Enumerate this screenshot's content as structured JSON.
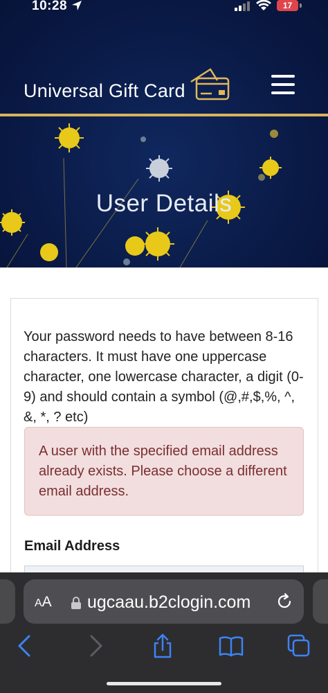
{
  "status_bar": {
    "time": "10:28",
    "battery": "17"
  },
  "header": {
    "brand": "Universal Gift Card",
    "hero_title": "User Details"
  },
  "content": {
    "password_hint": "Your password needs to have between 8-16 characters. It must have one uppercase character, one lowercase character, a digit (0-9) and should contain a symbol (@,#,$,%, ^, &, *, ? etc)",
    "error_message": "A user with the specified email address already exists. Please choose a different email address.",
    "email_label": "Email Address",
    "email_value": ""
  },
  "browser": {
    "aa_label_big": "A",
    "aa_label_small": "A",
    "url": "ugcaau.b2clogin.com"
  },
  "colors": {
    "navy": "#0b1a44",
    "gold": "#d9b45a",
    "error_bg": "#f2dede",
    "error_text": "#7a2e33",
    "browser_accent": "#3d83f6"
  },
  "icons": [
    "location-arrow-icon",
    "signal-icon",
    "wifi-icon",
    "battery-icon",
    "credit-card-icon",
    "hamburger-menu-icon",
    "lock-icon",
    "reload-icon",
    "back-icon",
    "forward-icon",
    "share-icon",
    "bookmarks-icon",
    "tabs-icon"
  ]
}
